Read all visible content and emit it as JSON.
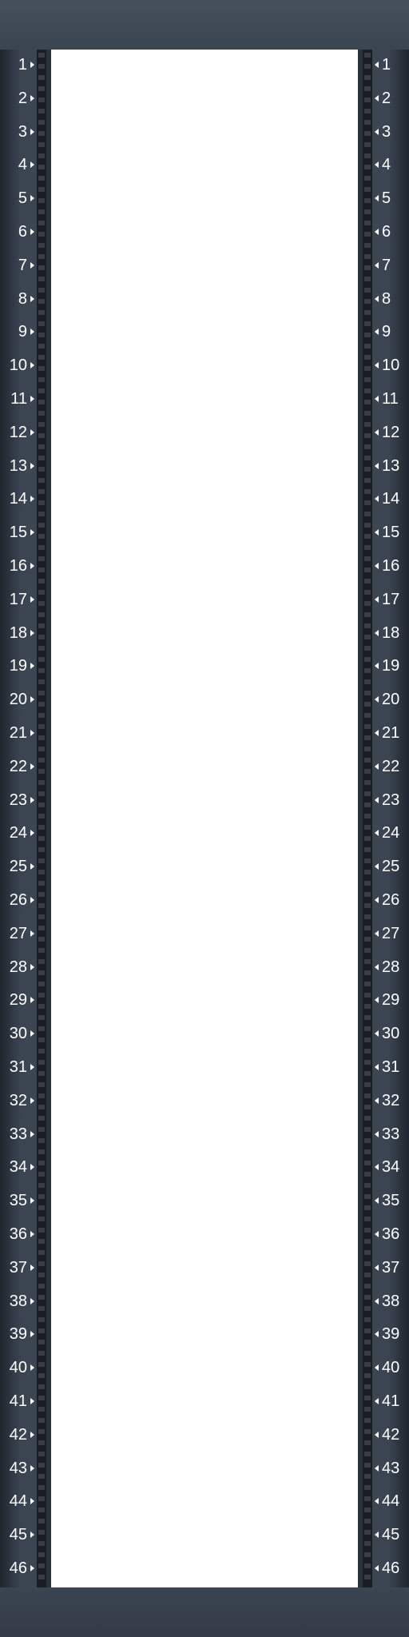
{
  "rack": {
    "units": [
      1,
      2,
      3,
      4,
      5,
      6,
      7,
      8,
      9,
      10,
      11,
      12,
      13,
      14,
      15,
      16,
      17,
      18,
      19,
      20,
      21,
      22,
      23,
      24,
      25,
      26,
      27,
      28,
      29,
      30,
      31,
      32,
      33,
      34,
      35,
      36,
      37,
      38,
      39,
      40,
      41,
      42,
      43,
      44,
      45,
      46
    ],
    "unit_color": "#ffffff",
    "frame_color": "#3d4754",
    "rail_color": "#1a1d22",
    "mounting_area_color": "#ffffff",
    "marker_icon": "triangle-marker-icon"
  }
}
